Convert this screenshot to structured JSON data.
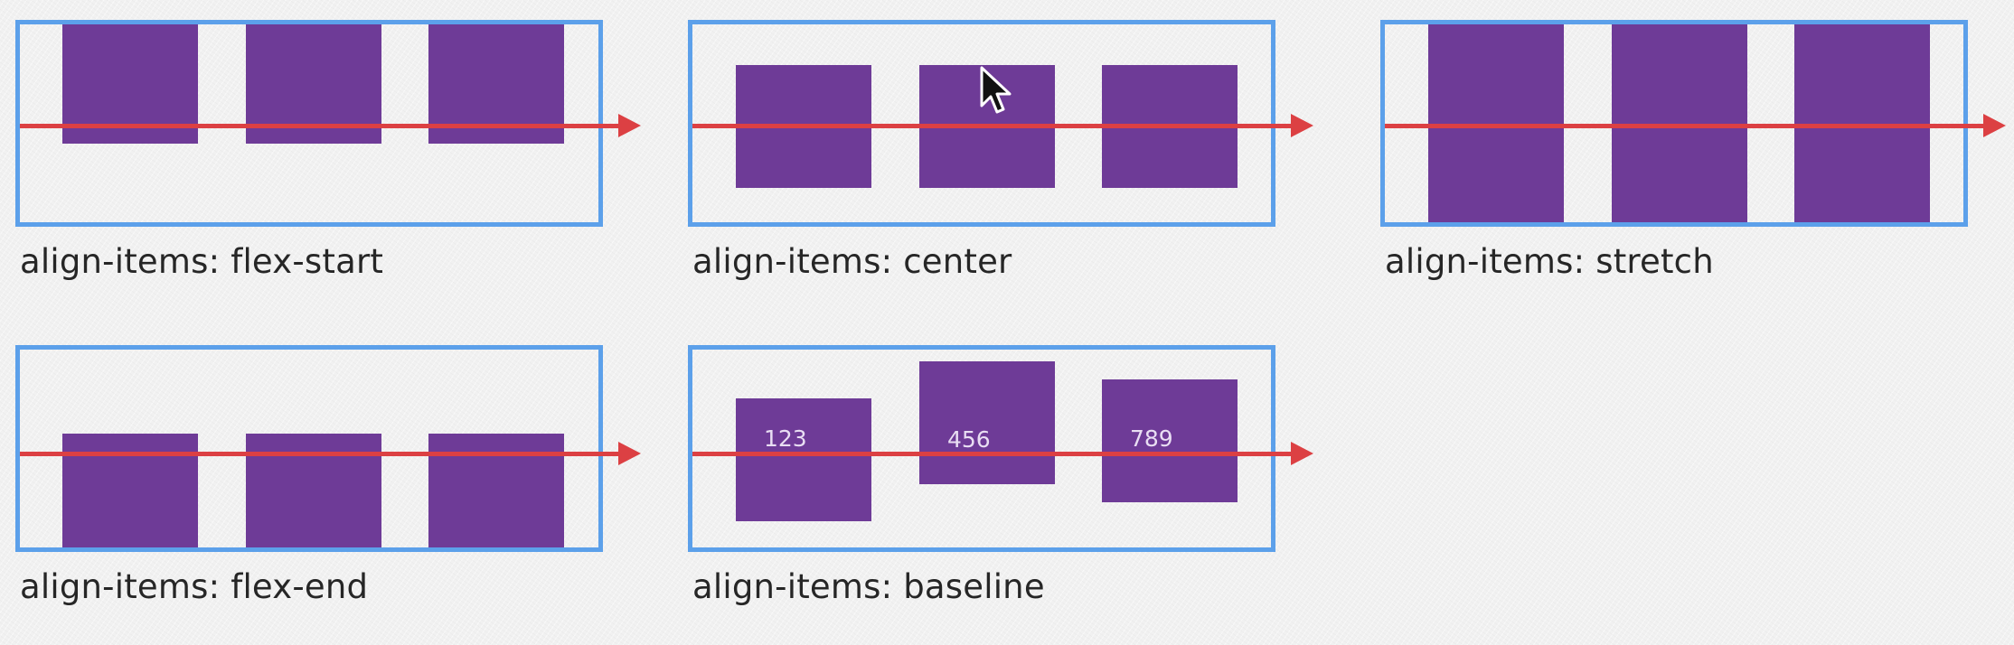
{
  "panels": [
    {
      "id": "flex-start",
      "caption": "align-items: flex-start"
    },
    {
      "id": "center",
      "caption": "align-items: center"
    },
    {
      "id": "stretch",
      "caption": "align-items: stretch"
    },
    {
      "id": "flex-end",
      "caption": "align-items: flex-end"
    },
    {
      "id": "baseline",
      "caption": "align-items: baseline",
      "items": [
        "123",
        "456",
        "789"
      ]
    }
  ],
  "colors": {
    "container_border": "#5ca0ea",
    "item_fill": "#6e3b97",
    "axis": "#dc4043",
    "caption_text": "#262626",
    "background": "#f1f1f1"
  },
  "icons": [
    "cursor-arrow-icon",
    "arrow-head-icon"
  ]
}
